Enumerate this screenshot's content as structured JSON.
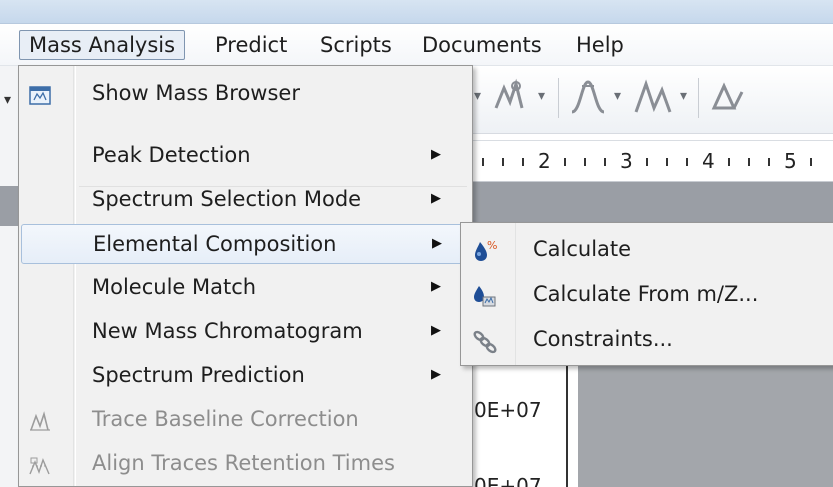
{
  "menubar": {
    "items": [
      "Mass Analysis",
      "Predict",
      "Scripts",
      "Documents",
      "Help"
    ],
    "active": "Mass Analysis"
  },
  "mass_analysis_menu": {
    "items": [
      {
        "label": "Show Mass Browser",
        "icon": "mass-browser-icon",
        "submenu": false,
        "enabled": true
      },
      {
        "label": "Peak Detection",
        "submenu": true,
        "enabled": true
      },
      {
        "label": "Spectrum Selection Mode",
        "submenu": true,
        "enabled": true
      },
      {
        "label": "Elemental Composition",
        "submenu": true,
        "enabled": true,
        "highlighted": true
      },
      {
        "label": "Molecule Match",
        "submenu": true,
        "enabled": true
      },
      {
        "label": "New Mass Chromatogram",
        "submenu": true,
        "enabled": true
      },
      {
        "label": "Spectrum Prediction",
        "submenu": true,
        "enabled": true
      },
      {
        "label": "Trace Baseline Correction",
        "icon": "baseline-correction-icon",
        "submenu": false,
        "enabled": false
      },
      {
        "label": "Align Traces Retention Times",
        "icon": "align-traces-icon",
        "submenu": false,
        "enabled": false
      }
    ]
  },
  "elemental_composition_submenu": {
    "items": [
      {
        "label": "Calculate",
        "icon": "calculate-icon"
      },
      {
        "label": "Calculate From m/Z...",
        "icon": "calculate-from-mz-icon"
      },
      {
        "label": "Constraints...",
        "icon": "constraints-icon"
      }
    ]
  },
  "ruler": {
    "labels": [
      "2",
      "3",
      "4",
      "5"
    ]
  },
  "plot": {
    "y_tick_labels": [
      "0E+07",
      "0E+07"
    ]
  },
  "colors": {
    "menu_bg": "#f1f1f1",
    "highlight_border": "#a8c0dc",
    "disabled_text": "#8d8d8d",
    "active_menu_bg": "#e8eef6"
  }
}
